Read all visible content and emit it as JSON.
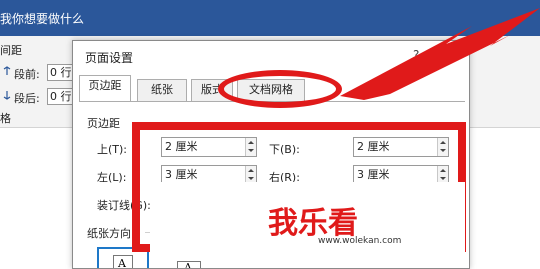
{
  "ribbon": {
    "tell_me": "我你想要做什么",
    "spacing_group": "间距",
    "before_label": "段前:",
    "before_value": "0 行",
    "after_label": "段后:",
    "after_value": "0 行",
    "bottom_fragment": "格"
  },
  "dialog": {
    "title": "页面设置",
    "help": "?",
    "close": "×",
    "tabs": [
      {
        "label": "页边距"
      },
      {
        "label": "纸张"
      },
      {
        "label": "版式"
      },
      {
        "label": "文档网格"
      }
    ],
    "margins_group": "页边距",
    "top_label": "上(T):",
    "top_value": "2 厘米",
    "bottom_label": "下(B):",
    "bottom_value": "2 厘米",
    "left_label": "左(L):",
    "left_value": "3 厘米",
    "right_label": "右(R):",
    "right_value": "3 厘米",
    "gutter_label": "装订线(G):",
    "orientation_group": "纸张方向",
    "portrait_glyph": "A",
    "landscape_glyph": "A"
  },
  "watermark": {
    "title": "我乐看",
    "url": "www.wolekan.com"
  },
  "colors": {
    "ribbon_blue": "#2b579a",
    "annotation_red": "#e01a1a",
    "selection_blue": "#1e78c8"
  }
}
